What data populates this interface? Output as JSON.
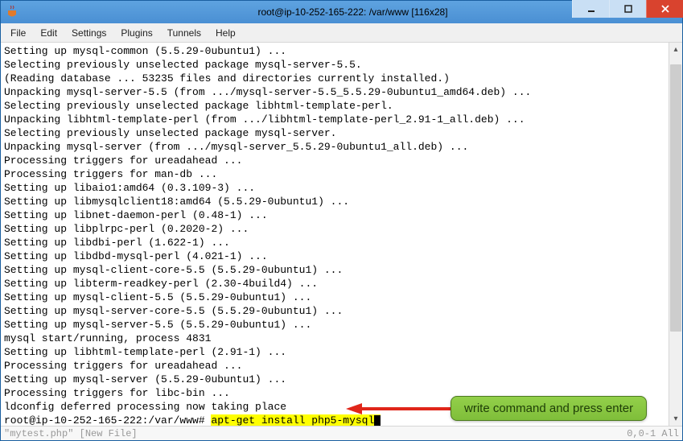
{
  "window": {
    "title": "root@ip-10-252-165-222: /var/www [116x28]"
  },
  "menu": {
    "file": "File",
    "edit": "Edit",
    "settings": "Settings",
    "plugins": "Plugins",
    "tunnels": "Tunnels",
    "help": "Help"
  },
  "terminal": {
    "lines": [
      "Setting up mysql-common (5.5.29-0ubuntu1) ...",
      "Selecting previously unselected package mysql-server-5.5.",
      "(Reading database ... 53235 files and directories currently installed.)",
      "Unpacking mysql-server-5.5 (from .../mysql-server-5.5_5.5.29-0ubuntu1_amd64.deb) ...",
      "Selecting previously unselected package libhtml-template-perl.",
      "Unpacking libhtml-template-perl (from .../libhtml-template-perl_2.91-1_all.deb) ...",
      "Selecting previously unselected package mysql-server.",
      "Unpacking mysql-server (from .../mysql-server_5.5.29-0ubuntu1_all.deb) ...",
      "Processing triggers for ureadahead ...",
      "Processing triggers for man-db ...",
      "Setting up libaio1:amd64 (0.3.109-3) ...",
      "Setting up libmysqlclient18:amd64 (5.5.29-0ubuntu1) ...",
      "Setting up libnet-daemon-perl (0.48-1) ...",
      "Setting up libplrpc-perl (0.2020-2) ...",
      "Setting up libdbi-perl (1.622-1) ...",
      "Setting up libdbd-mysql-perl (4.021-1) ...",
      "Setting up mysql-client-core-5.5 (5.5.29-0ubuntu1) ...",
      "Setting up libterm-readkey-perl (2.30-4build4) ...",
      "Setting up mysql-client-5.5 (5.5.29-0ubuntu1) ...",
      "Setting up mysql-server-core-5.5 (5.5.29-0ubuntu1) ...",
      "Setting up mysql-server-5.5 (5.5.29-0ubuntu1) ...",
      "mysql start/running, process 4831",
      "Setting up libhtml-template-perl (2.91-1) ...",
      "Processing triggers for ureadahead ...",
      "Setting up mysql-server (5.5.29-0ubuntu1) ...",
      "Processing triggers for libc-bin ...",
      "ldconfig deferred processing now taking place"
    ],
    "prompt_prefix": "root@ip-10-252-165-222:/var/www# ",
    "command": "apt-get install php5-mysql"
  },
  "statusbar": {
    "left": "\"mytest.php\" [New File]",
    "right": "0,0-1         All"
  },
  "callout": {
    "text": "write command and press enter"
  }
}
